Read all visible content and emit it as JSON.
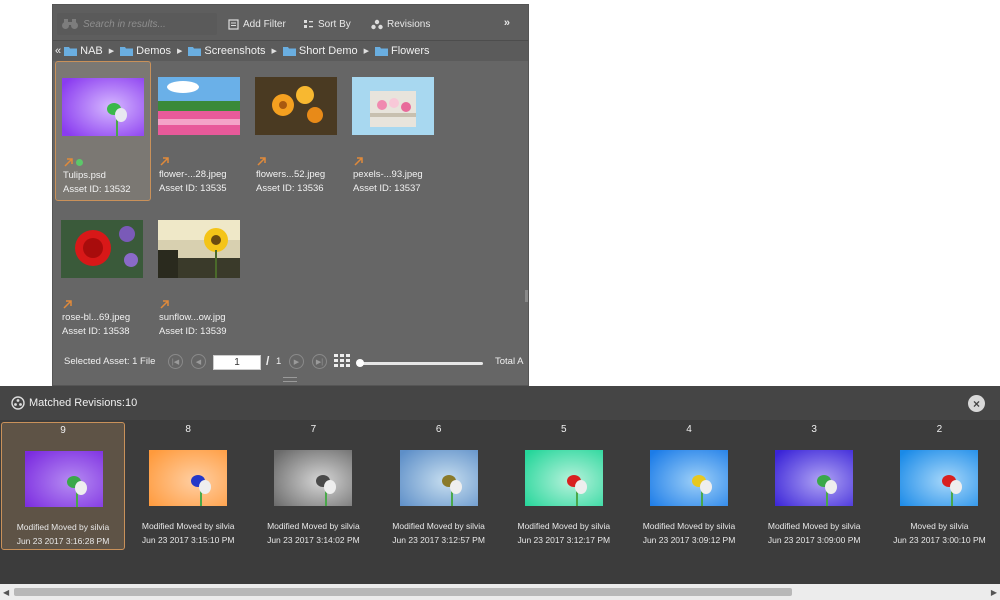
{
  "toolbar": {
    "search_placeholder": "Search in results...",
    "add_filter": "Add Filter",
    "sort_by": "Sort By",
    "revisions": "Revisions",
    "more": "»"
  },
  "breadcrumb": {
    "back": "«",
    "items": [
      "NAB",
      "Demos",
      "Screenshots",
      "Short Demo",
      "Flowers"
    ]
  },
  "assets": [
    {
      "name": "Tulips.psd",
      "id": "Asset ID: 13532",
      "thumb": "tulip-purple",
      "selected": true
    },
    {
      "name": "flower-...28.jpeg",
      "id": "Asset ID: 13535",
      "thumb": "flower-field"
    },
    {
      "name": "flowers...52.jpeg",
      "id": "Asset ID: 13536",
      "thumb": "orange-flowers"
    },
    {
      "name": "pexels-...93.jpeg",
      "id": "Asset ID: 13537",
      "thumb": "flower-basket"
    },
    {
      "name": "rose-bl...69.jpeg",
      "id": "Asset ID: 13538",
      "thumb": "red-rose"
    },
    {
      "name": "sunflow...ow.jpg",
      "id": "Asset ID: 13539",
      "thumb": "sunflower"
    }
  ],
  "pager": {
    "selected_label": "Selected Asset: 1 File",
    "page_value": "1",
    "slash": "/",
    "total_pages": "1",
    "total_label": "Total A"
  },
  "revisions": {
    "title": "Matched Revisions:10",
    "close": "×",
    "items": [
      {
        "num": "9",
        "desc": "Modified Moved by silvia",
        "date": "Jun 23 2017 3:16:28 PM",
        "bg": [
          "#7b2be0",
          "#b68cf2"
        ],
        "flower": "#3aa84a",
        "selected": true
      },
      {
        "num": "8",
        "desc": "Modified Moved by silvia",
        "date": "Jun 23 2017 3:15:10 PM",
        "bg": [
          "#ff9a3c",
          "#ffcfa3"
        ],
        "flower": "#2438c8"
      },
      {
        "num": "7",
        "desc": "Modified Moved by silvia",
        "date": "Jun 23 2017 3:14:02 PM",
        "bg": [
          "#6a6a6a",
          "#d6d6d6"
        ],
        "flower": "#4a4a4a"
      },
      {
        "num": "6",
        "desc": "Modified Moved by silvia",
        "date": "Jun 23 2017 3:12:57 PM",
        "bg": [
          "#5e8fc8",
          "#c8dff0"
        ],
        "flower": "#8a7a2a"
      },
      {
        "num": "5",
        "desc": "Modified Moved by silvia",
        "date": "Jun 23 2017 3:12:17 PM",
        "bg": [
          "#25d69a",
          "#b8f2dc"
        ],
        "flower": "#d82020"
      },
      {
        "num": "4",
        "desc": "Modified Moved by silvia",
        "date": "Jun 23 2017 3:09:12 PM",
        "bg": [
          "#1c7ce8",
          "#9ed0f8"
        ],
        "flower": "#e8c820"
      },
      {
        "num": "3",
        "desc": "Modified Moved by silvia",
        "date": "Jun 23 2017 3:09:00 PM",
        "bg": [
          "#3a24d8",
          "#b0a4f4"
        ],
        "flower": "#3aa84a"
      },
      {
        "num": "2",
        "desc": "Moved by silvia",
        "date": "Jun 23 2017 3:00:10 PM",
        "bg": [
          "#1a8ae8",
          "#a8d8fa"
        ],
        "flower": "#d82020"
      }
    ]
  },
  "colors": {
    "panel": "#666666",
    "revisions_panel": "#3c3c3c",
    "selection_border": "#c9915a",
    "folder": "#6aaee0"
  }
}
